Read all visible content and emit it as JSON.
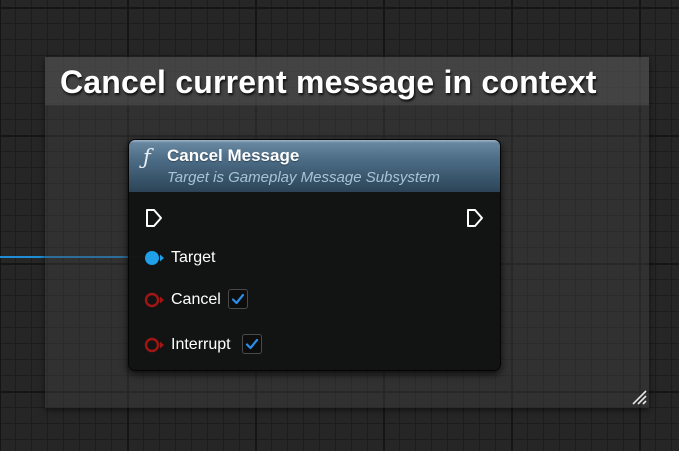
{
  "comment": {
    "title": "Cancel current message in context"
  },
  "node": {
    "icon": "function-icon",
    "title": "Cancel Message",
    "subtitle": "Target is Gameplay Message Subsystem",
    "exec_in": "exec-in-pin",
    "exec_out": "exec-out-pin",
    "pins": [
      {
        "label": "Target",
        "type": "object",
        "color": "#1fa0e8",
        "connected": true
      },
      {
        "label": "Cancel",
        "type": "bool",
        "color": "#a11515",
        "checked": true
      },
      {
        "label": "Interrupt",
        "type": "bool",
        "color": "#a11515",
        "checked": true
      }
    ]
  },
  "colors": {
    "wire": "#1e8fd6",
    "header_top": "#6c8ca6",
    "header_bottom": "#2c4457",
    "checkmark": "#2d8ee8"
  }
}
